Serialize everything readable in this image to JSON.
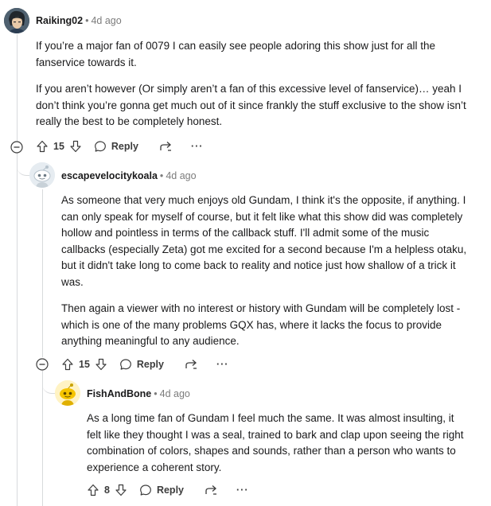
{
  "comments": [
    {
      "author": "Raiking02",
      "separator": "•",
      "time": "4d ago",
      "paragraphs": [
        "If you’re a major fan of 0079 I can easily see people adoring this show just for all the fanservice towards it.",
        "If you aren’t however (Or simply aren’t a fan of this excessive level of fanservice)… yeah I don’t think you’re gonna get much out of it since frankly the stuff exclusive to the show isn’t really the best to be completely honest."
      ],
      "votes": "15",
      "reply_label": "Reply",
      "more_label": "···"
    },
    {
      "author": "escapevelocitykoala",
      "separator": "•",
      "time": "4d ago",
      "paragraphs": [
        "As someone that very much enjoys old Gundam, I think it's the opposite, if anything. I can only speak for myself of course, but it felt like what this show did was completely hollow and pointless in terms of the callback stuff. I'll admit some of the music callbacks (especially Zeta) got me excited for a second because I'm a helpless otaku, but it didn't take long to come back to reality and notice just how shallow of a trick it was.",
        "Then again a viewer with no interest or history with Gundam will be completely lost - which is one of the many problems GQX has, where it lacks the focus to provide anything meaningful to any audience."
      ],
      "votes": "15",
      "reply_label": "Reply",
      "more_label": "···"
    },
    {
      "author": "FishAndBone",
      "separator": "•",
      "time": "4d ago",
      "paragraphs": [
        "As a long time fan of Gundam I feel much the same. It was almost insulting, it felt like they thought I was a seal, trained to bark and clap upon seeing the right combination of colors, shapes and sounds, rather than a person who wants to experience a coherent story."
      ],
      "votes": "8",
      "reply_label": "Reply",
      "more_label": "···"
    }
  ],
  "colors": {
    "text": "#1a1a1b",
    "meta": "#7c7c7c",
    "thread_line": "#d8dadc",
    "icon": "#3c3c3c"
  },
  "icons": [
    "avatar",
    "collapse-icon",
    "upvote-icon",
    "downvote-icon",
    "reply-icon",
    "share-icon",
    "more-icon"
  ]
}
